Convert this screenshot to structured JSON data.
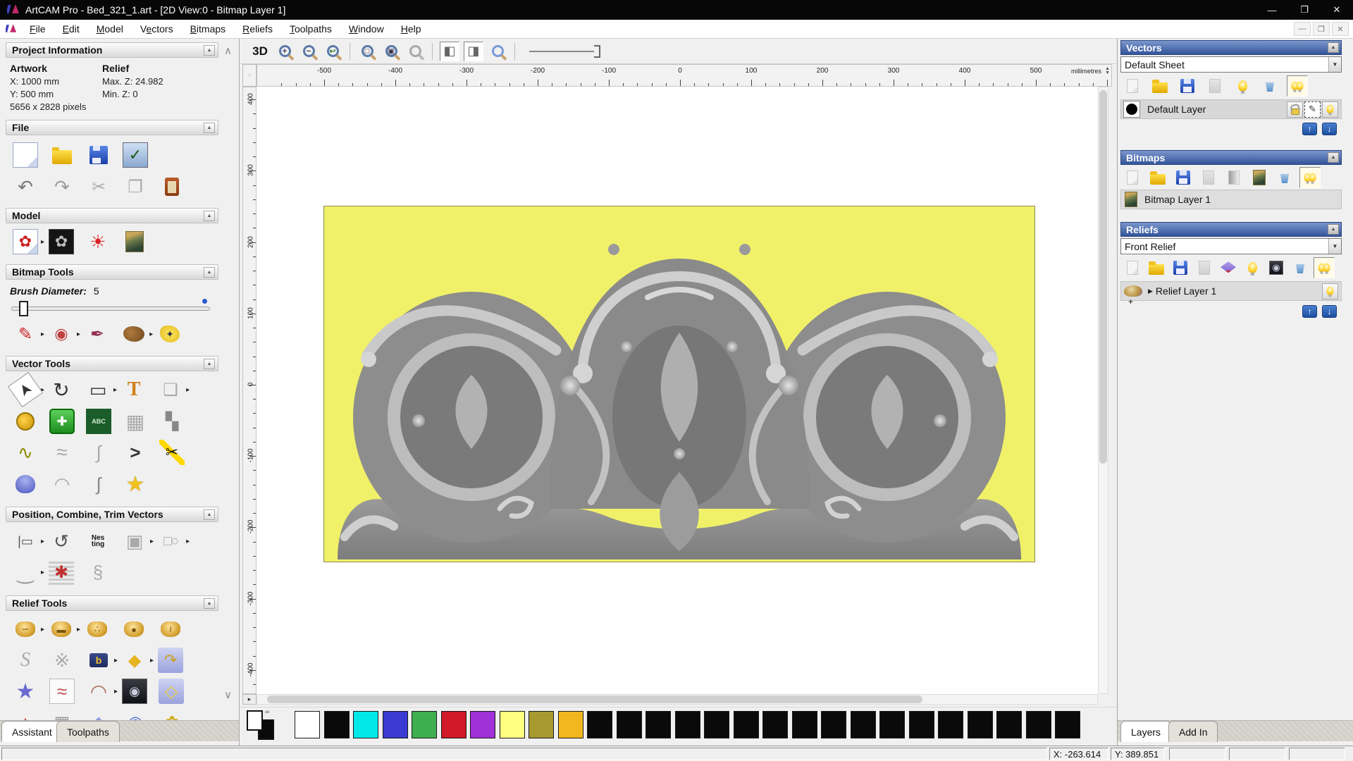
{
  "window": {
    "title": "ArtCAM Pro - Bed_321_1.art - [2D View:0 - Bitmap Layer 1]"
  },
  "menu": {
    "items": [
      {
        "label": "File",
        "u": 0
      },
      {
        "label": "Edit",
        "u": 0
      },
      {
        "label": "Model",
        "u": 0
      },
      {
        "label": "Vectors",
        "u": 1
      },
      {
        "label": "Bitmaps",
        "u": 0
      },
      {
        "label": "Reliefs",
        "u": 0
      },
      {
        "label": "Toolpaths",
        "u": 0
      },
      {
        "label": "Window",
        "u": 0
      },
      {
        "label": "Help",
        "u": 0
      }
    ]
  },
  "left_panel": {
    "project_information": {
      "title": "Project Information",
      "artwork_label": "Artwork",
      "relief_label": "Relief",
      "x": "X: 1000 mm",
      "y": "Y: 500 mm",
      "pixels": "5656 x 2828 pixels",
      "max_z": "Max. Z: 24.982",
      "min_z": "Min. Z: 0"
    },
    "file_section": {
      "title": "File"
    },
    "model_section": {
      "title": "Model"
    },
    "bitmap_tools": {
      "title": "Bitmap Tools",
      "brush_label": "Brush Diameter:",
      "brush_value": "5"
    },
    "vector_tools": {
      "title": "Vector Tools"
    },
    "position_section": {
      "title": "Position, Combine, Trim Vectors"
    },
    "relief_tools": {
      "title": "Relief Tools"
    },
    "tabs": [
      {
        "label": "Assistant",
        "active": true
      },
      {
        "label": "Toolpaths",
        "active": false
      }
    ]
  },
  "view_toolbar": {
    "mode_3d": "3D"
  },
  "ruler": {
    "units": "millimetres",
    "h_ticks": [
      -500,
      -400,
      -300,
      -200,
      -100,
      0,
      100,
      200,
      300,
      400,
      500
    ],
    "v_ticks": [
      400,
      300,
      200,
      100,
      0,
      -100,
      -200,
      -300,
      -400
    ]
  },
  "canvas": {
    "artwork_background": "#f1f169",
    "relief_base_gray": "#8a8a8a"
  },
  "palette": {
    "colors": [
      "#ffffff",
      "#0a0a0a",
      "#00e8e8",
      "#3a3ad2",
      "#3fae4e",
      "#d01828",
      "#a030d8",
      "#ffff80",
      "#a89a30",
      "#f2b71e",
      "#0a0a0a",
      "#0a0a0a",
      "#0a0a0a",
      "#0a0a0a",
      "#0a0a0a",
      "#0a0a0a",
      "#0a0a0a",
      "#0a0a0a",
      "#0a0a0a",
      "#0a0a0a",
      "#0a0a0a",
      "#0a0a0a",
      "#0a0a0a",
      "#0a0a0a",
      "#0a0a0a",
      "#0a0a0a",
      "#0a0a0a"
    ]
  },
  "right_panel": {
    "vectors": {
      "title": "Vectors",
      "sheet": "Default Sheet",
      "layer": "Default Layer"
    },
    "bitmaps": {
      "title": "Bitmaps",
      "layer": "Bitmap Layer 1"
    },
    "reliefs": {
      "title": "Reliefs",
      "relief": "Front Relief",
      "layer": "Relief Layer 1"
    },
    "tabs": [
      {
        "label": "Layers",
        "active": true
      },
      {
        "label": "Add In",
        "active": false
      }
    ]
  },
  "status_bar": {
    "x": "X: -263.614",
    "y": "Y: 389.851"
  },
  "icons": {
    "minimize": "—",
    "restore": "❐",
    "close": "✕",
    "mdi_minimize": "—",
    "mdi_restore": "❐",
    "mdi_close": "✕",
    "collapse": "▲",
    "dropdown": "▼",
    "scroll_up": "∧",
    "scroll_down": "∨",
    "new_file": "❏",
    "check": "✓",
    "undo": "↶",
    "redo": "↷",
    "cut": "✂",
    "copy": "❐",
    "bear": "✿",
    "lamp": "☀",
    "pencil": "✎",
    "flood": "◉",
    "picker": "✒",
    "magic": "✦",
    "select": "➤",
    "transform": "↻",
    "rect": "▭",
    "text": "T",
    "sheet": "❑",
    "plus": "✚",
    "abc": "ABC",
    "grid": "▦",
    "dots": "▚",
    "node": "∿",
    "scribble": "≈",
    "curvefit": "∫",
    "angle": ">",
    "trim": "✂",
    "arc": "◠",
    "section": "ʃ",
    "star": "★",
    "align": "|▭",
    "textcurve": "↺",
    "nesting": "Nes ting",
    "group": "▣",
    "weld": "□○",
    "join": "‿",
    "stamp": "✱",
    "rings": "§",
    "g1": "∽",
    "g2": "▬",
    "g3": "∴",
    "g4": "●",
    "g5": "≀",
    "s": "S",
    "knot": "※",
    "b": "b",
    "diam": "◆",
    "flip": "↷",
    "smooth": "≈",
    "emboss": "◉",
    "offset": "◇",
    "r41": "▲",
    "r42": "▦",
    "r43": "◆",
    "r44": "◉",
    "r45": "✿",
    "up": "↑",
    "down": "↓",
    "snap": "✎",
    "expand": "▶",
    "flyout": "▸",
    "mag_plus": "+",
    "mag_minus": "−",
    "mag_prev": "↩",
    "mag_11": "□",
    "mag_fit": "▣",
    "toggle_bitmap": "◧",
    "toggle_vector": "◨",
    "corner_grid": "⁘",
    "hscroll_nub": "▸",
    "chip_link": "∞"
  }
}
